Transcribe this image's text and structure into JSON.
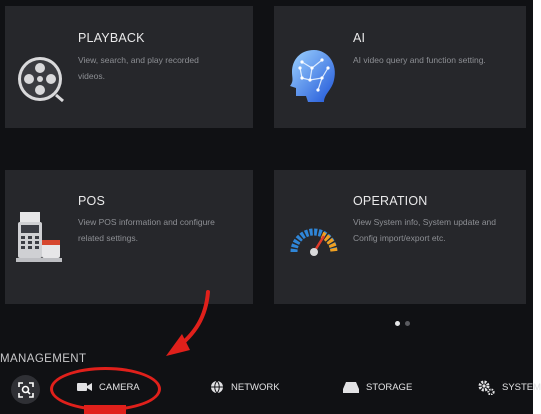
{
  "tiles": [
    {
      "id": "playback",
      "title": "PLAYBACK",
      "desc_line1": "View, search, and play recorded",
      "desc_line2": "videos.",
      "icon": "film-reel-icon"
    },
    {
      "id": "ai",
      "title": "AI",
      "desc_line1": "AI video query and function setting.",
      "desc_line2": "",
      "icon": "ai-head-icon"
    },
    {
      "id": "pos",
      "title": "POS",
      "desc_line1": "View POS information and configure",
      "desc_line2": "related settings.",
      "icon": "pos-terminal-icon"
    },
    {
      "id": "operation",
      "title": "OPERATION",
      "desc_line1": "View System info, System update and",
      "desc_line2": "Config import/export etc.",
      "icon": "gauge-icon"
    }
  ],
  "pagination": {
    "current": 1,
    "total": 2
  },
  "management": {
    "title": "MANAGEMENT",
    "items": [
      {
        "label": "CAMERA",
        "icon": "camera-icon"
      },
      {
        "label": "NETWORK",
        "icon": "globe-icon"
      },
      {
        "label": "STORAGE",
        "icon": "storage-icon"
      },
      {
        "label": "SYSTEM",
        "icon": "gears-icon"
      }
    ]
  },
  "colors": {
    "accent_red": "#e0201b",
    "tile_bg": "#26272b",
    "screen_bg": "#101114"
  }
}
